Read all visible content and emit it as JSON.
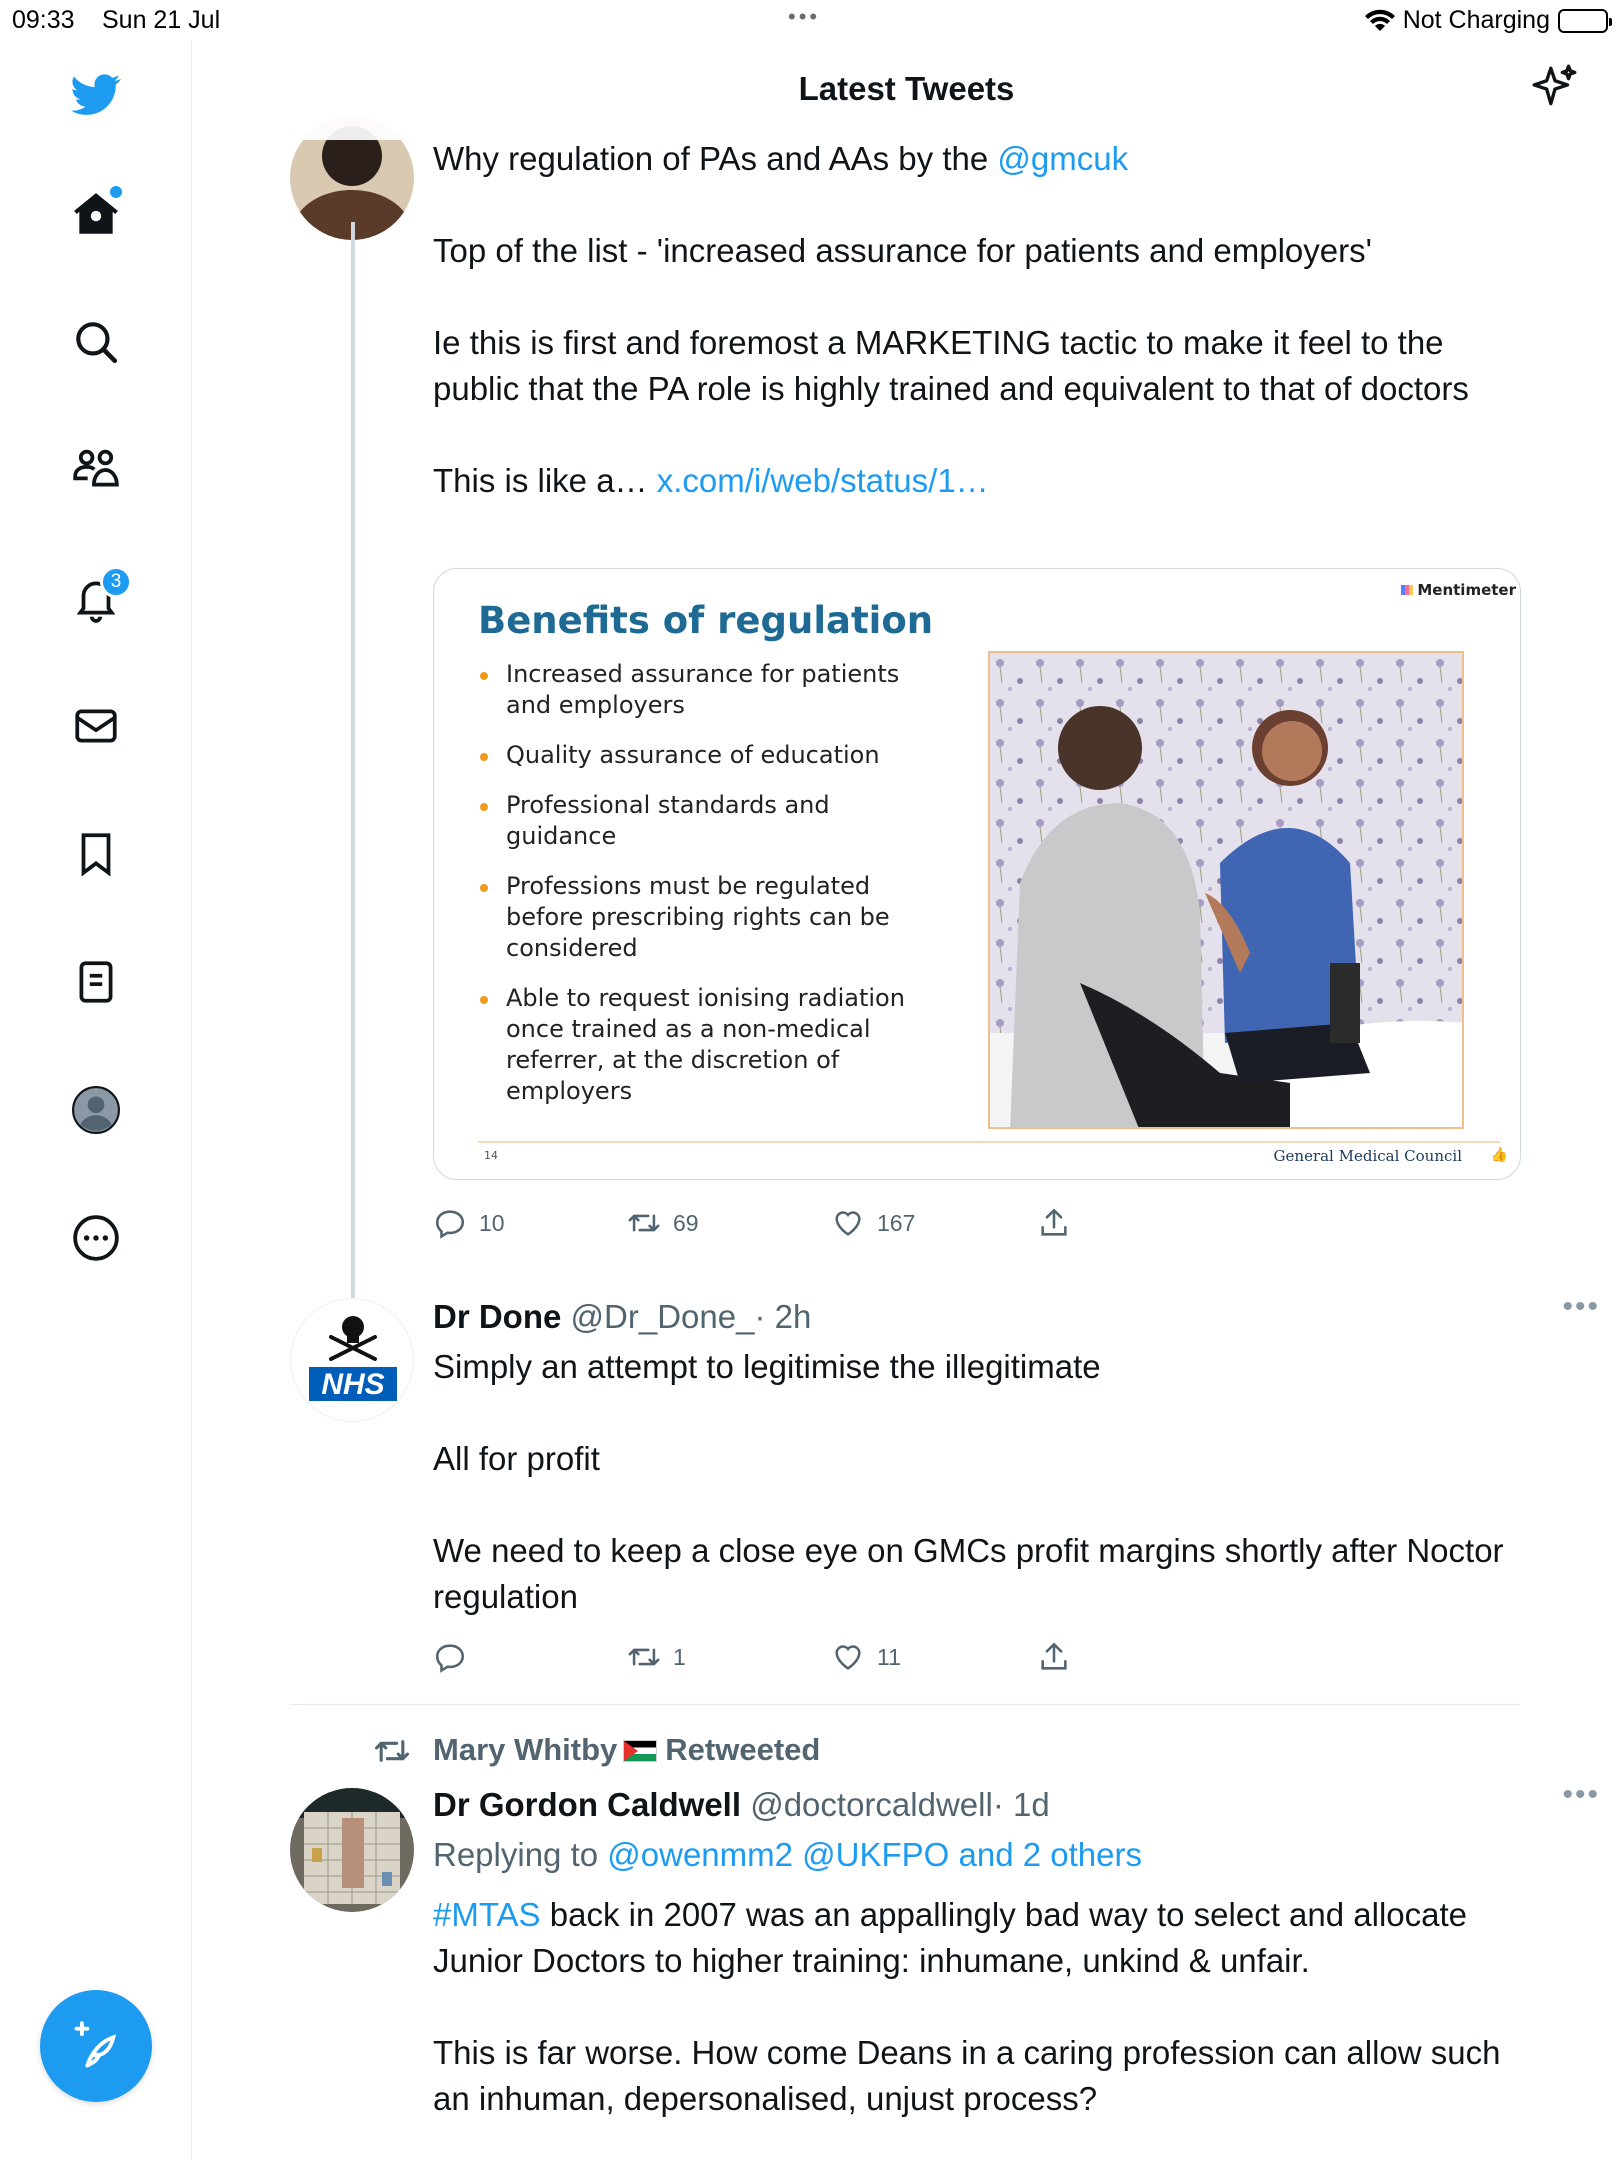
{
  "status_bar": {
    "time": "09:33",
    "date": "Sun 21 Jul",
    "charging": "Not Charging"
  },
  "sidebar": {
    "notifications_badge": "3"
  },
  "header": {
    "title": "Latest Tweets"
  },
  "tweet1": {
    "line1_prefix": "Why regulation of PAs and AAs by the ",
    "line1_mention": "@gmcuk",
    "para2": "Top of the list - 'increased assurance for patients and employers'",
    "para3": "Ie this is first and foremost a MARKETING tactic to make it feel to the public that the PA role is highly trained and equivalent to that of doctors",
    "para4_prefix": "This is like a… ",
    "para4_link": "x.com/i/web/status/1…",
    "media": {
      "brand": "Mentimeter",
      "slide_title": "Benefits of regulation",
      "bullets": [
        "Increased assurance for patients and employers",
        "Quality assurance of education",
        "Professional standards and guidance",
        "Professions must be regulated before prescribing rights can be considered",
        "Able to request ionising radiation once trained as a non-medical referrer, at the discretion of employers"
      ],
      "slide_number": "14",
      "footer": "General Medical Council"
    },
    "actions": {
      "replies": "10",
      "retweets": "69",
      "likes": "167"
    }
  },
  "tweet2": {
    "name": "Dr Done",
    "handle": "@Dr_Done_",
    "time": "· 2h",
    "avatar_text": "NHS",
    "para1": "Simply an attempt to legitimise the illegitimate",
    "para2": "All for profit",
    "para3": "We need to keep a close eye on GMCs profit margins shortly after Noctor regulation",
    "actions": {
      "replies": "",
      "retweets": "1",
      "likes": "11"
    }
  },
  "tweet3": {
    "retweeted_by": "Mary Whitby",
    "retweeted_label": "Retweeted",
    "name": "Dr Gordon Caldwell",
    "handle": "@doctorcaldwell",
    "time": "· 1d",
    "replying_prefix": "Replying to ",
    "replying_targets": "@owenmm2 @UKFPO and 2 others",
    "para1_hashtag": "#MTAS",
    "para1_rest": " back in 2007 was an appallingly bad way to select and allocate Junior Doctors to higher training: inhumane, unkind & unfair.",
    "para2": "This is far worse. How come Deans in a caring profession can allow such an inhuman, depersonalised, unjust process?"
  },
  "colors": {
    "accent": "#1d9bf0",
    "text": "#0f1419",
    "secondary": "#536471",
    "slide_title": "#1e6a95",
    "bullet": "#f29a1e"
  }
}
